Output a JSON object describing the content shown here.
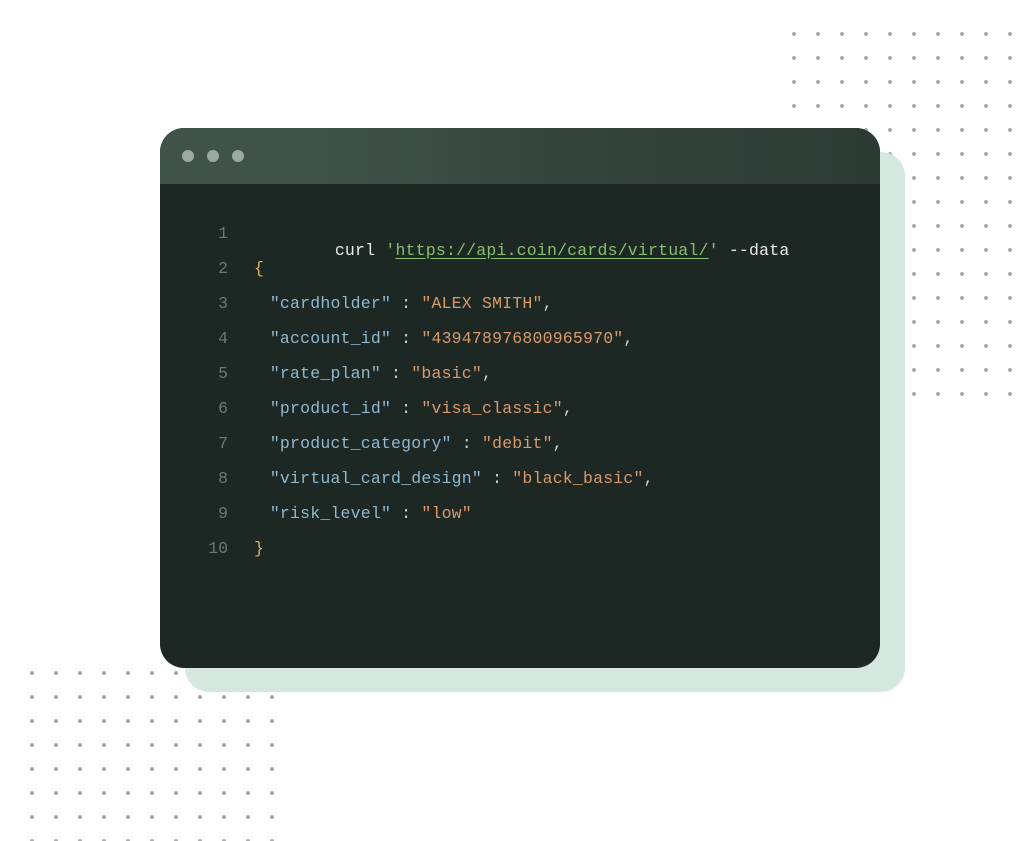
{
  "titlebar": {
    "buttons": 3
  },
  "code": {
    "line1": {
      "cmd": "curl ",
      "q": "'",
      "url": "https://api.coin/cards/virtual/",
      "flag": " --data"
    },
    "brace_open": "{",
    "brace_close": "}",
    "fields": [
      {
        "key": "\"cardholder\"",
        "val": "\"ALEX SMITH\"",
        "comma": ","
      },
      {
        "key": "\"account_id\"",
        "val": "\"439478976800965970\"",
        "comma": ","
      },
      {
        "key": "\"rate_plan\"",
        "val": "\"basic\"",
        "comma": ","
      },
      {
        "key": "\"product_id\"",
        "val": "\"visa_classic\"",
        "comma": ","
      },
      {
        "key": "\"product_category\"",
        "val": "\"debit\"",
        "comma": ","
      },
      {
        "key": "\"virtual_card_design\"",
        "val": "\"black_basic\"",
        "comma": ","
      },
      {
        "key": "\"risk_level\"",
        "val": "\"low\"",
        "comma": ""
      }
    ],
    "line_numbers": [
      "1",
      "2",
      "3",
      "4",
      "5",
      "6",
      "7",
      "8",
      "9",
      "10"
    ]
  }
}
